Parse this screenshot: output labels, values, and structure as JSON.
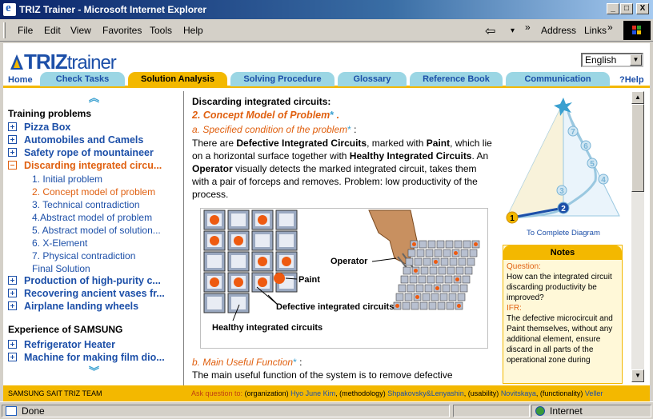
{
  "window": {
    "title": "TRIZ Trainer - Microsoft Internet Explorer",
    "min": "_",
    "max": "□",
    "close": "X"
  },
  "menu": [
    "File",
    "Edit",
    "View",
    "Favorites",
    "Tools",
    "Help"
  ],
  "toolbar": {
    "back": "⇦",
    "dropdown": "▾",
    "more": "»",
    "address": "Address",
    "links": "Links",
    "more2": "»"
  },
  "app": {
    "logo_triz": "TRIZ",
    "logo_trainer": "trainer",
    "language": "English",
    "home": "Home",
    "help": "?Help",
    "tabs": [
      "Check Tasks",
      "Solution Analysis",
      "Solving Procedure",
      "Glossary",
      "Reference Book",
      "Communication"
    ],
    "active_tab": "Solution Analysis"
  },
  "sidebar": {
    "section1": "Training problems",
    "problems_top": [
      "Pizza Box",
      "Automobiles and Camels",
      "Safety rope of mountaineer"
    ],
    "active_problem": "Discarding integrated circu...",
    "steps": [
      "1. Initial problem",
      "2. Concept model of problem",
      "3. Technical contradiction",
      "4.Abstract model of problem",
      "5. Abstract model of solution...",
      "6. X-Element",
      "7. Physical contradiction",
      "Final Solution"
    ],
    "active_step": "2. Concept model of problem",
    "problems_bottom": [
      "Production of high-purity c...",
      "Recovering ancient vases fr...",
      "Airplane landing wheels"
    ],
    "section2": "Experience of SAMSUNG",
    "samsung": [
      "Refrigerator Heater",
      "Machine for making film dio..."
    ]
  },
  "content": {
    "title": "Discarding integrated circuits:",
    "subtitle": "2. Concept Model of Problem",
    "sub_a": "a. Specified condition of the problem",
    "sub_a_tail": " :",
    "para": [
      {
        "t": "There are ",
        "b": false
      },
      {
        "t": "Defective Integrated Circuits",
        "b": true
      },
      {
        "t": ", marked with ",
        "b": false
      },
      {
        "t": "Paint",
        "b": true
      },
      {
        "t": ", which lie on a horizontal surface together with ",
        "b": false
      },
      {
        "t": "Healthy Integrated Circuits",
        "b": true
      },
      {
        "t": ". An ",
        "b": false
      },
      {
        "t": "Operator",
        "b": true
      },
      {
        "t": " visually detects the marked integrated circuit, takes them with a pair of forceps and removes. Problem: low productivity of the process.",
        "b": false
      }
    ],
    "figure_labels": {
      "operator": "Operator",
      "paint": "Paint",
      "defective": "Defective integrated circuits",
      "healthy": "Healthy integrated circuits"
    },
    "sub_b": "b. Main Useful Function",
    "sub_b_tail": " :",
    "para_b": "The main useful function of the system is to remove defective"
  },
  "diagram": {
    "link": "To Complete Diagram",
    "nodes": [
      "1",
      "2",
      "3",
      "4",
      "5",
      "6",
      "7"
    ],
    "current": "2"
  },
  "notes": {
    "header": "Notes",
    "q_label": "Question:",
    "question": "How can the integrated circuit discarding productivity be improved?",
    "ifr_label": "IFR:",
    "ifr": "The defective microcircuit and Paint themselves, without any additional element, ensure discard in all parts of the operational zone during"
  },
  "footer": {
    "team": "SAMSUNG SAIT TRIZ TEAM",
    "ask": "Ask question to:",
    "contacts": [
      {
        "role": "(organization)",
        "name": "Hyo June Kim"
      },
      {
        "role": "(methodology)",
        "name": "Shpakovsky&Lenyashin"
      },
      {
        "role": "(usability)",
        "name": "Novitskaya"
      },
      {
        "role": "(functionality)",
        "name": "Veller"
      }
    ]
  },
  "status": {
    "text": "Done",
    "zone": "Internet"
  },
  "colors": {
    "brand_blue": "#1c4fa8",
    "accent_orange": "#e06010",
    "tab_cyan": "#9bd6e4",
    "gold": "#f3b800"
  }
}
